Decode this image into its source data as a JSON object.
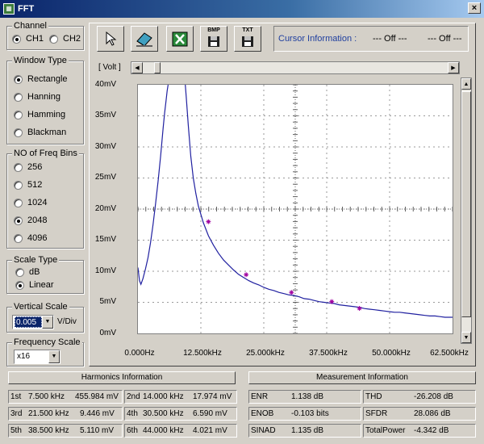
{
  "window": {
    "title": "FFT",
    "close": "×"
  },
  "channel": {
    "title": "Channel",
    "options": [
      {
        "label": "CH1",
        "selected": true
      },
      {
        "label": "CH2",
        "selected": false
      }
    ]
  },
  "window_type": {
    "title": "Window Type",
    "options": [
      {
        "label": "Rectangle",
        "selected": true
      },
      {
        "label": "Hanning",
        "selected": false
      },
      {
        "label": "Hamming",
        "selected": false
      },
      {
        "label": "Blackman",
        "selected": false
      }
    ]
  },
  "freq_bins": {
    "title": "NO of Freq Bins",
    "options": [
      {
        "label": "256",
        "selected": false
      },
      {
        "label": "512",
        "selected": false
      },
      {
        "label": "1024",
        "selected": false
      },
      {
        "label": "2048",
        "selected": true
      },
      {
        "label": "4096",
        "selected": false
      }
    ]
  },
  "scale_type": {
    "title": "Scale Type",
    "options": [
      {
        "label": "dB",
        "selected": false
      },
      {
        "label": "Linear",
        "selected": true
      }
    ]
  },
  "vertical_scale": {
    "title": "Vertical Scale",
    "value": "0.005",
    "unit": "V/Div"
  },
  "frequency_scale": {
    "title": "Frequency Scale",
    "value": "x16"
  },
  "toolbar": {
    "bmp_label": "BMP",
    "txt_label": "TXT"
  },
  "cursor_info": {
    "label": "Cursor Information :",
    "value1": "--- Off ---",
    "value2": "--- Off ---"
  },
  "chart_data": {
    "type": "line",
    "ylabel": "[ Volt ]",
    "y_ticks": [
      "40mV",
      "35mV",
      "30mV",
      "25mV",
      "20mV",
      "15mV",
      "10mV",
      "5mV",
      "0mV"
    ],
    "x_ticks": [
      "0.000Hz",
      "12.500kHz",
      "25.000kHz",
      "37.500kHz",
      "50.000kHz",
      "62.500kHz"
    ],
    "xlim": [
      0,
      62.5
    ],
    "ylim": [
      0,
      40
    ],
    "grid": true,
    "series": [
      {
        "color": "#2020a0",
        "x": [
          0,
          0.3,
          0.6,
          1.0,
          1.5,
          2.0,
          2.5,
          3.0,
          3.5,
          4.0,
          4.5,
          5.0,
          5.3,
          5.6,
          5.8,
          6.0,
          9.4,
          9.6,
          10.0,
          10.5,
          11.0,
          11.5,
          12.0,
          13.0,
          14.0,
          15.0,
          16.0,
          17.0,
          18.0,
          19.0,
          20.0,
          21.0,
          22.0,
          23.0,
          24.0,
          25.0,
          26.0,
          27.0,
          28.0,
          29.0,
          30.0,
          31.0,
          32.0,
          33.0,
          34.0,
          35.0,
          36.0,
          37.0,
          38.0,
          39.0,
          40.0,
          41.0,
          42.0,
          43.0,
          44.0,
          45.0,
          46.0,
          47.0,
          48.0,
          49.0,
          50.0,
          51.0,
          52.0,
          53.0,
          54.0,
          55.0,
          56.0,
          57.0,
          58.0,
          59.0,
          60.0,
          61.0,
          62.5
        ],
        "y": [
          10.6,
          8.5,
          7.9,
          8.8,
          10.4,
          12.2,
          14.6,
          17.5,
          20.8,
          24.5,
          28.5,
          33.0,
          35.5,
          37.5,
          39.0,
          40.0,
          40.0,
          38.0,
          33.5,
          28.5,
          25.0,
          22.5,
          20.5,
          17.8,
          15.7,
          14.2,
          12.9,
          11.8,
          11.0,
          10.2,
          9.5,
          9.0,
          8.5,
          8.1,
          7.8,
          7.4,
          7.1,
          6.9,
          6.6,
          6.4,
          6.2,
          6.1,
          5.9,
          5.6,
          5.5,
          5.3,
          5.1,
          5.0,
          4.9,
          4.8,
          4.6,
          4.5,
          4.4,
          4.3,
          4.2,
          4.0,
          3.9,
          3.8,
          3.7,
          3.6,
          3.5,
          3.4,
          3.4,
          3.3,
          3.2,
          3.1,
          3.0,
          2.9,
          2.8,
          2.8,
          2.7,
          2.6,
          2.6
        ]
      }
    ],
    "markers": [
      {
        "x": 14.0,
        "y": 17.97,
        "color": "#a000a0"
      },
      {
        "x": 21.5,
        "y": 9.45,
        "color": "#a000a0"
      },
      {
        "x": 30.5,
        "y": 6.59,
        "color": "#a000a0"
      },
      {
        "x": 38.5,
        "y": 5.11,
        "color": "#a000a0"
      },
      {
        "x": 44.0,
        "y": 4.02,
        "color": "#a000a0"
      }
    ]
  },
  "harmonics": {
    "title": "Harmonics Information",
    "rows": [
      [
        {
          "label": "1st",
          "freq": "7.500 kHz",
          "value": "455.984 mV"
        },
        {
          "label": "2nd",
          "freq": "14.000 kHz",
          "value": "17.974 mV"
        }
      ],
      [
        {
          "label": "3rd",
          "freq": "21.500 kHz",
          "value": "9.446 mV"
        },
        {
          "label": "4th",
          "freq": "30.500 kHz",
          "value": "6.590 mV"
        }
      ],
      [
        {
          "label": "5th",
          "freq": "38.500 kHz",
          "value": "5.110 mV"
        },
        {
          "label": "6th",
          "freq": "44.000 kHz",
          "value": "4.021 mV"
        }
      ]
    ]
  },
  "measurement": {
    "title": "Measurement Information",
    "rows": [
      [
        {
          "label": "ENR",
          "value": "1.138 dB"
        },
        {
          "label": "THD",
          "value": "-26.208 dB"
        }
      ],
      [
        {
          "label": "ENOB",
          "value": "-0.103 bits"
        },
        {
          "label": "SFDR",
          "value": "28.086 dB"
        }
      ],
      [
        {
          "label": "SINAD",
          "value": "1.135 dB"
        },
        {
          "label": "TotalPower",
          "value": "-4.342 dB"
        }
      ]
    ]
  }
}
